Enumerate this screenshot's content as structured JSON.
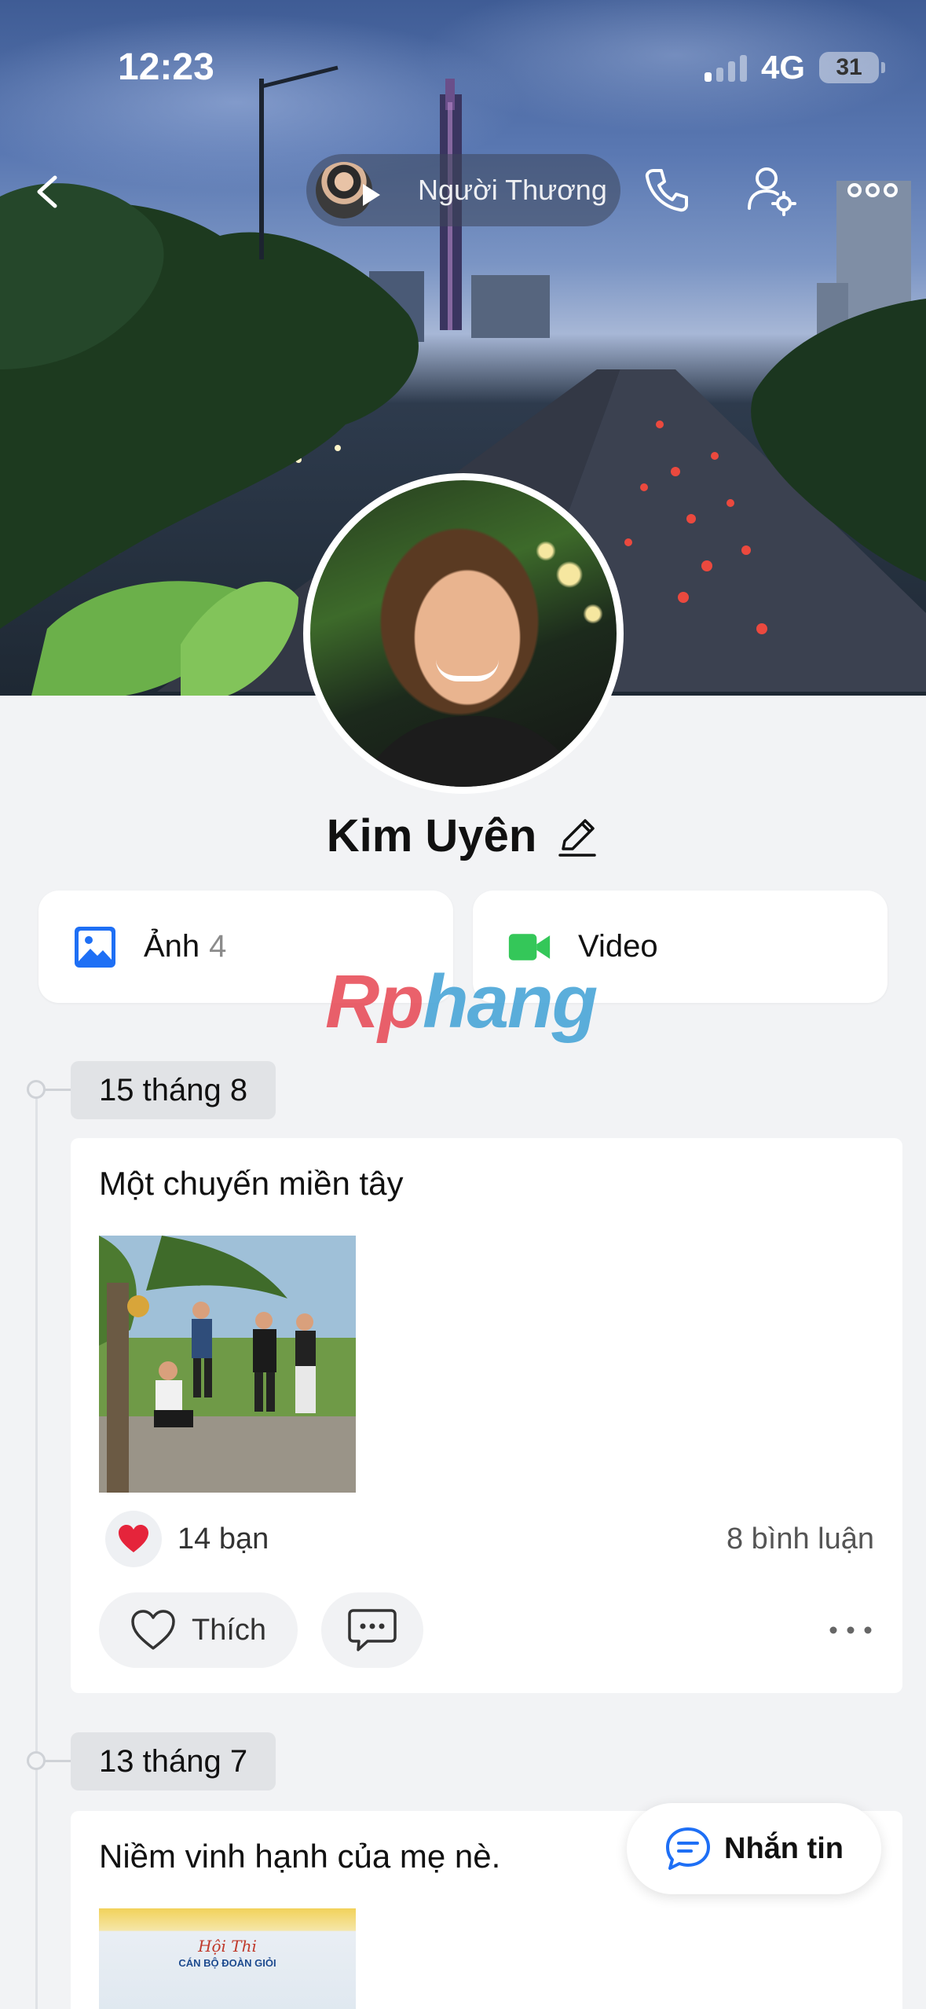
{
  "status_bar": {
    "time": "12:23",
    "network": "4G",
    "battery": "31"
  },
  "header": {
    "song_title": "Người Thương"
  },
  "profile": {
    "name": "Kim Uyên"
  },
  "media": {
    "photos_label": "Ảnh",
    "photos_count": "4",
    "video_label": "Video"
  },
  "watermark": {
    "text_a": "Rp",
    "text_b": "hang"
  },
  "posts": [
    {
      "date": "15 tháng 8",
      "text": "Một chuyến miền tây",
      "likes": "14 bạn",
      "comments": "8 bình luận",
      "like_label": "Thích"
    },
    {
      "date": "13 tháng 7",
      "text": "Niềm vinh hạnh của mẹ nè.",
      "photo_caption": "Hội Thi",
      "photo_subcaption": "CÁN BỘ ĐOÀN GIỎI"
    }
  ],
  "fab": {
    "message_label": "Nhắn tin"
  },
  "colors": {
    "accent_blue": "#1e6ff5",
    "video_green": "#34c759",
    "heart_red": "#e5243b",
    "background": "#f2f3f5"
  },
  "icons": {
    "back": "chevron-left-icon",
    "call": "phone-icon",
    "settings": "user-settings-icon",
    "more": "more-icon",
    "edit": "pencil-icon",
    "photo": "image-icon",
    "video": "video-camera-icon",
    "heart": "heart-icon",
    "comment": "comment-icon",
    "message": "message-icon"
  }
}
